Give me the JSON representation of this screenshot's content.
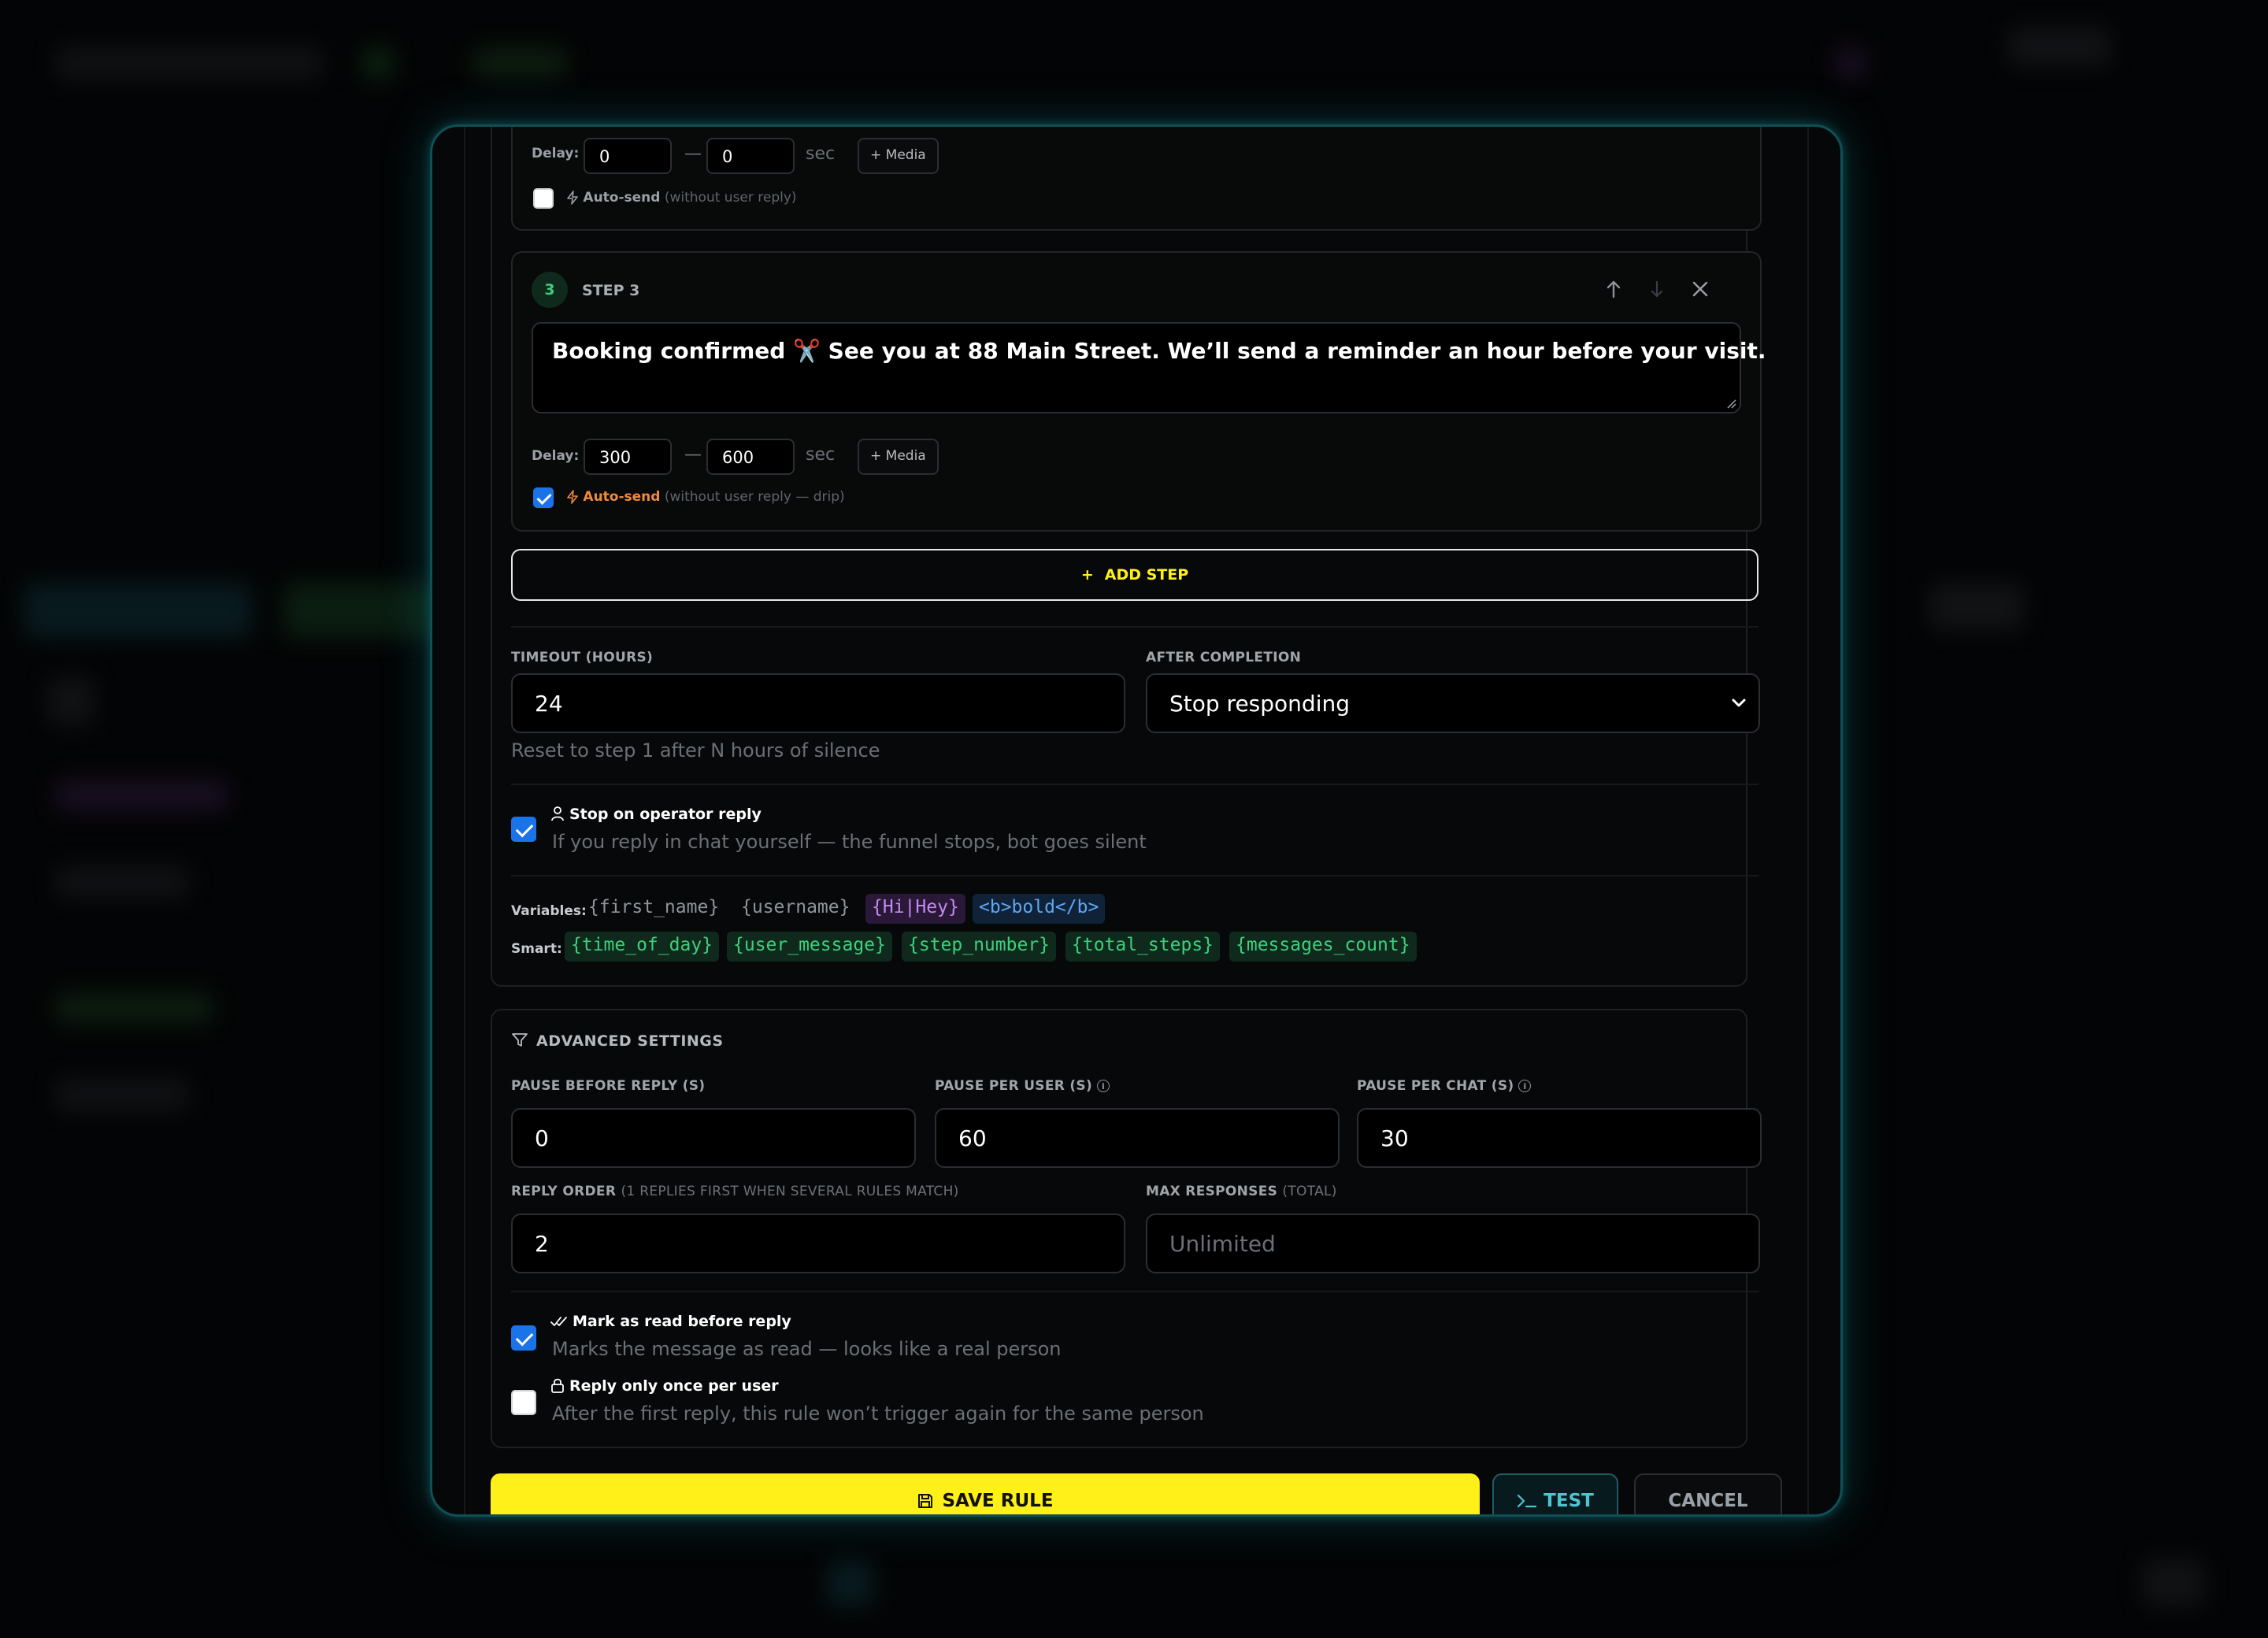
{
  "step2": {
    "delay_label": "Delay:",
    "delay_min": "0",
    "delay_dash": "—",
    "delay_max": "0",
    "delay_unit": "sec",
    "media_label": "+ Media",
    "autosend_label": "Auto-send",
    "autosend_hint": "(without user reply)",
    "autosend_checked": false
  },
  "step3": {
    "number": "3",
    "title": "STEP 3",
    "message_prefix": "Booking confirmed",
    "message_emoji": "✂️",
    "message_rest": "See you at 88 Main Street. We’ll send a reminder an hour before your visit.",
    "delay_label": "Delay:",
    "delay_min": "300",
    "delay_dash": "—",
    "delay_max": "600",
    "delay_unit": "sec",
    "media_label": "+ Media",
    "autosend_label": "Auto-send",
    "autosend_hint": "(without user reply — drip)",
    "autosend_checked": true
  },
  "add_step_label": "ADD STEP",
  "add_step_plus": "+",
  "timeout": {
    "label": "TIMEOUT (HOURS)",
    "value": "24",
    "hint": "Reset to step 1 after N hours of silence"
  },
  "after_completion": {
    "label": "AFTER COMPLETION",
    "value": "Stop responding"
  },
  "stop_on_operator": {
    "title": "Stop on operator reply",
    "hint": "If you reply in chat yourself — the funnel stops, bot goes silent",
    "checked": true
  },
  "variables": {
    "label": "Variables:",
    "items": [
      "{first_name}",
      "{username}",
      "{Hi|Hey}",
      "<b>bold</b>"
    ]
  },
  "smart": {
    "label": "Smart:",
    "items": [
      "{time_of_day}",
      "{user_message}",
      "{step_number}",
      "{total_steps}",
      "{messages_count}"
    ]
  },
  "advanced": {
    "title": "ADVANCED SETTINGS",
    "pause_before_reply": {
      "label": "PAUSE BEFORE REPLY (S)",
      "value": "0"
    },
    "pause_per_user": {
      "label": "PAUSE PER USER (S)",
      "value": "60"
    },
    "pause_per_chat": {
      "label": "PAUSE PER CHAT (S)",
      "value": "30"
    },
    "reply_order": {
      "label": "REPLY ORDER",
      "label_hint": "(1 REPLIES FIRST WHEN SEVERAL RULES MATCH)",
      "value": "2"
    },
    "max_responses": {
      "label": "MAX RESPONSES",
      "label_hint": "(TOTAL)",
      "placeholder": "Unlimited"
    },
    "mark_as_read": {
      "title": "Mark as read before reply",
      "hint": "Marks the message as read — looks like a real person",
      "checked": true
    },
    "reply_once": {
      "title": "Reply only once per user",
      "hint": "After the first reply, this rule won’t trigger again for the same person",
      "checked": false
    }
  },
  "footer": {
    "save_label": "SAVE RULE",
    "test_label": "TEST",
    "cancel_label": "CANCEL"
  },
  "colors": {
    "accent_yellow": "#fff01a",
    "autosend_orange": "#f08a3c",
    "checkbox_blue": "#1a73e8",
    "modal_border": "#0f4f55"
  }
}
